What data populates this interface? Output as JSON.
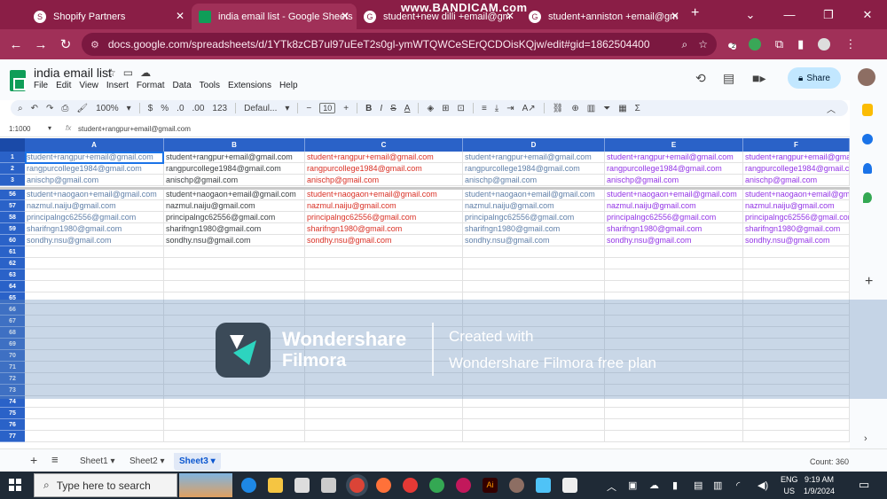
{
  "browser": {
    "tabs": [
      {
        "title": "Shopify Partners",
        "active": false
      },
      {
        "title": "india email list - Google Sheets",
        "active": true
      },
      {
        "title": "student+new dilli +email@gm",
        "active": false
      },
      {
        "title": "student+anniston +email@gm",
        "active": false
      }
    ],
    "url": "docs.google.com/spreadsheets/d/1YTk8zCB7ul97uEeT2s0gl-ymWTQWCeSErQCDOisKQjw/edit#gid=1862504400",
    "recording_overlay": "www.BANDICAM.com",
    "extension_badge": "2"
  },
  "sheets_header": {
    "title": "india email list",
    "menu": [
      "File",
      "Edit",
      "View",
      "Insert",
      "Format",
      "Data",
      "Tools",
      "Extensions",
      "Help"
    ],
    "share_label": "Share"
  },
  "toolbar": {
    "zoom": "100%",
    "currency": "$",
    "percent": "%",
    "decrease_decimal": ".0",
    "increase_decimal": ".00",
    "number_format": "123",
    "font": "Defaul...",
    "font_size": "10",
    "bold": "B",
    "italic": "I",
    "strike": "S",
    "text_color": "A",
    "sigma": "Σ"
  },
  "formula_bar": {
    "name_box": "1:1000",
    "fx": "fx",
    "value": "student+rangpur+email@gmail.com"
  },
  "grid": {
    "columns": [
      "A",
      "B",
      "C",
      "D",
      "E",
      "F"
    ],
    "top_rows": [
      {
        "num": "1",
        "cells": [
          "student+rangpur+email@gmail.com",
          "student+rangpur+email@gmail.com",
          "student+rangpur+email@gmail.com",
          "student+rangpur+email@gmail.com",
          "student+rangpur+email@gmail.com",
          "student+rangpur+email@gmail.c"
        ]
      },
      {
        "num": "2",
        "cells": [
          "rangpurcollege1984@gmail.com",
          "rangpurcollege1984@gmail.com",
          "rangpurcollege1984@gmail.com",
          "rangpurcollege1984@gmail.com",
          "rangpurcollege1984@gmail.com",
          "rangpurcollege1984@gmail.co"
        ]
      },
      {
        "num": "3",
        "cells": [
          "anischp@gmail.com",
          "anischp@gmail.com",
          "anischp@gmail.com",
          "anischp@gmail.com",
          "anischp@gmail.com",
          "anischp@gmail.com"
        ]
      }
    ],
    "body_rows": [
      {
        "num": "56",
        "cells": [
          "student+naogaon+email@gmail.com",
          "student+naogaon+email@gmail.com",
          "student+naogaon+email@gmail.com",
          "student+naogaon+email@gmail.com",
          "student+naogaon+email@gmail.com",
          "student+naogaon+email@gmai"
        ]
      },
      {
        "num": "57",
        "cells": [
          "nazmul.naiju@gmail.com",
          "nazmul.naiju@gmail.com",
          "nazmul.naiju@gmail.com",
          "nazmul.naiju@gmail.com",
          "nazmul.naiju@gmail.com",
          "nazmul.naiju@gmail.com"
        ]
      },
      {
        "num": "58",
        "cells": [
          "principalngc62556@gmail.com",
          "principalngc62556@gmail.com",
          "principalngc62556@gmail.com",
          "principalngc62556@gmail.com",
          "principalngc62556@gmail.com",
          "principalngc62556@gmail.com"
        ]
      },
      {
        "num": "59",
        "cells": [
          "sharifngn1980@gmail.com",
          "sharifngn1980@gmail.com",
          "sharifngn1980@gmail.com",
          "sharifngn1980@gmail.com",
          "sharifngn1980@gmail.com",
          "sharifngn1980@gmail.com"
        ]
      },
      {
        "num": "60",
        "cells": [
          "sondhy.nsu@gmail.com",
          "sondhy.nsu@gmail.com",
          "sondhy.nsu@gmail.com",
          "sondhy.nsu@gmail.com",
          "sondhy.nsu@gmail.com",
          "sondhy.nsu@gmail.com"
        ]
      }
    ],
    "empty_rows": [
      "61",
      "62",
      "63",
      "64",
      "65",
      "66",
      "67",
      "68",
      "69",
      "70",
      "71",
      "72",
      "73",
      "74",
      "75",
      "76",
      "77"
    ],
    "column_colors": [
      "#5f7fa8",
      "#3c4043",
      "#d93025",
      "#5f7fa8",
      "#9334e6",
      "#9334e6"
    ]
  },
  "sheet_tabs": {
    "tabs": [
      "Sheet1",
      "Sheet2",
      "Sheet3"
    ],
    "active": "Sheet3",
    "count": "Count: 360"
  },
  "watermark": {
    "brand_line1": "Wondershare",
    "brand_line2": "Filmora",
    "created_with": "Created with",
    "plan": "Wondershare Filmora free plan"
  },
  "taskbar": {
    "search_placeholder": "Type here to search",
    "lang_line1": "ENG",
    "lang_line2": "US",
    "time": "9:19 AM",
    "date": "1/9/2024"
  },
  "colors": {
    "browser_frame": "#8a1e46",
    "header_blue": "#2a62c8",
    "share_bg": "#c2e7ff"
  }
}
